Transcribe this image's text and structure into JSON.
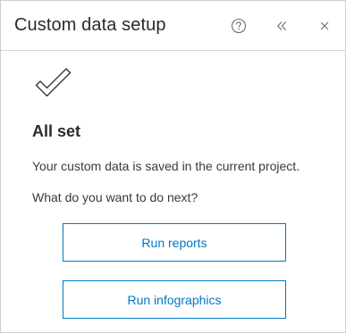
{
  "panel": {
    "title": "Custom data setup"
  },
  "header_icons": {
    "help": "question-circle-icon",
    "collapse": "double-chevron-left-icon",
    "close": "close-icon"
  },
  "status": {
    "icon": "checkmark-icon",
    "heading": "All set",
    "saved_message": "Your custom data is saved in the current project.",
    "next_prompt": "What do you want to do next?"
  },
  "actions": {
    "run_reports": "Run reports",
    "run_infographics": "Run infographics"
  },
  "colors": {
    "accent": "#0079c1",
    "text": "#323232",
    "border": "#cfcfcf"
  }
}
